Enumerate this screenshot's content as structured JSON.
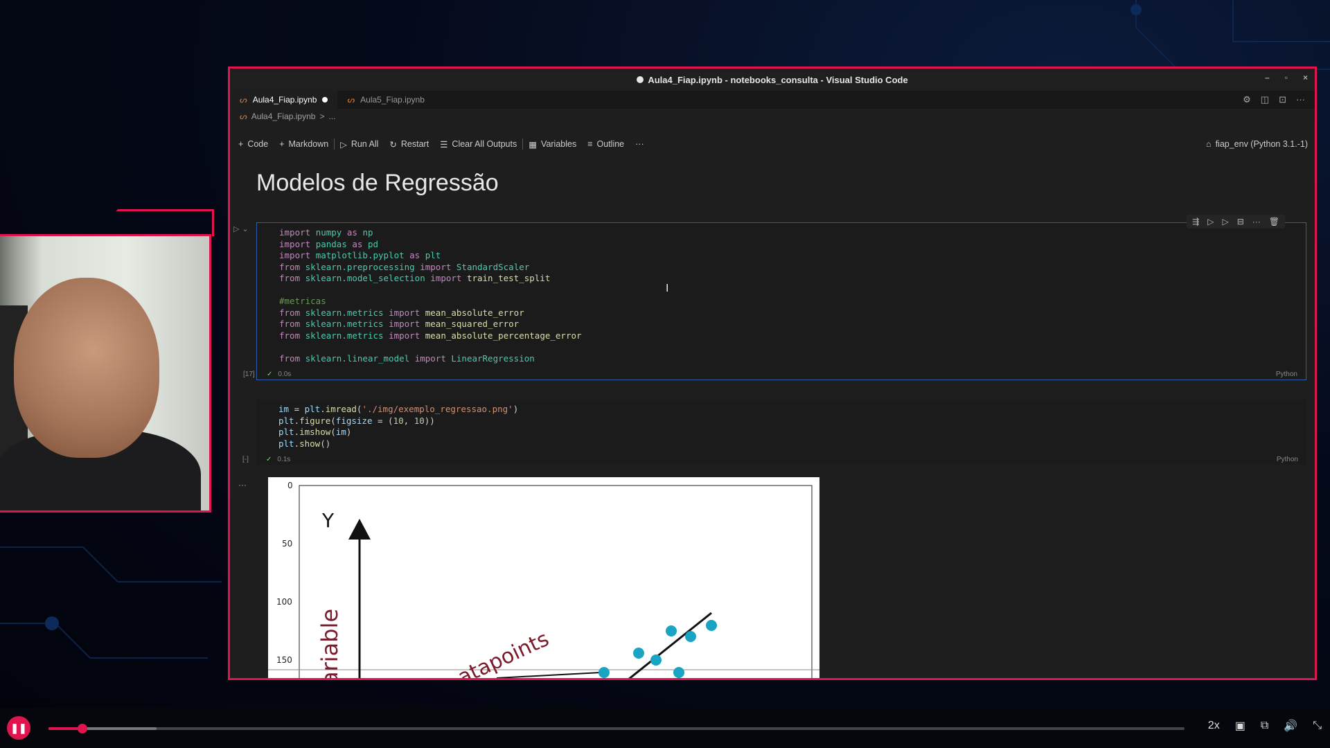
{
  "window": {
    "title": "Aula4_Fiap.ipynb - notebooks_consulta - Visual Studio Code",
    "controls": [
      "–",
      "▫",
      "×"
    ]
  },
  "tabs": [
    {
      "label": "Aula4_Fiap.ipynb",
      "active": true,
      "modified": true
    },
    {
      "label": "Aula5_Fiap.ipynb",
      "active": false,
      "modified": false
    }
  ],
  "breadcrumb": {
    "file": "Aula4_Fiap.ipynb",
    "sep": ">",
    "more": "..."
  },
  "toolbar": {
    "code": "Code",
    "markdown": "Markdown",
    "run_all": "Run All",
    "restart": "Restart",
    "clear_outputs": "Clear All Outputs",
    "variables": "Variables",
    "outline": "Outline",
    "more": "···",
    "kernel": "fiap_env (Python 3.1.-1)"
  },
  "notebook": {
    "title": "Modelos de Regressão",
    "cell1": {
      "exec_count": "[17]",
      "status": "✓",
      "time": "0.0s",
      "language": "Python"
    },
    "cell2": {
      "exec_count": "[-]",
      "status": "✓",
      "time": "0.1s",
      "language": "Python",
      "output_more": "···"
    }
  },
  "output_plot": {
    "y_ticks": [
      "0",
      "50",
      "100",
      "150"
    ],
    "y_axis_label": "Y",
    "variable_text": "ariable",
    "datapoints_text": "atapoints"
  },
  "player": {
    "speed": "2x",
    "progress_fraction": 0.03,
    "buffer_fraction": 0.095
  },
  "colors": {
    "accent": "#e0154f",
    "editor_bg": "#1e1e1e"
  }
}
